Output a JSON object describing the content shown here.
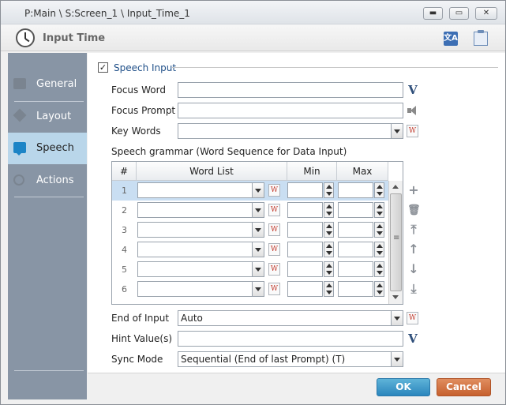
{
  "window": {
    "title": "P:Main \\ S:Screen_1 \\ Input_Time_1",
    "controls": {
      "minimize": "▬",
      "maximize": "▭",
      "close": "✕"
    }
  },
  "header": {
    "title": "Input Time",
    "icons": [
      "clock-icon",
      "translate-icon",
      "clipboard-icon"
    ]
  },
  "sidebar": {
    "items": [
      {
        "label": "General",
        "icon": "general-icon",
        "active": false
      },
      {
        "label": "Layout",
        "icon": "layout-icon",
        "active": false
      },
      {
        "label": "Speech",
        "icon": "speech-icon",
        "active": true
      },
      {
        "label": "Actions",
        "icon": "actions-icon",
        "active": false
      }
    ]
  },
  "speech": {
    "section_title": "Speech Input",
    "section_checked": true,
    "checkbox_mark": "✓",
    "focus_word": {
      "label": "Focus Word",
      "value": ""
    },
    "focus_prompt": {
      "label": "Focus Prompt",
      "value": ""
    },
    "key_words": {
      "label": "Key Words",
      "value": ""
    },
    "grammar_title": "Speech grammar (Word Sequence for Data Input)",
    "table": {
      "columns": [
        "#",
        "Word List",
        "Min",
        "Max"
      ],
      "rows": [
        {
          "num": "1",
          "word_list": "",
          "min": "",
          "max": ""
        },
        {
          "num": "2",
          "word_list": "",
          "min": "",
          "max": ""
        },
        {
          "num": "3",
          "word_list": "",
          "min": "",
          "max": ""
        },
        {
          "num": "4",
          "word_list": "",
          "min": "",
          "max": ""
        },
        {
          "num": "5",
          "word_list": "",
          "min": "",
          "max": ""
        },
        {
          "num": "6",
          "word_list": "",
          "min": "",
          "max": ""
        }
      ],
      "selected_row": "1"
    },
    "end_of_input": {
      "label": "End of Input",
      "value": "Auto"
    },
    "hint_value": {
      "label": "Hint Value(s)",
      "value": ""
    },
    "sync_mode": {
      "label": "Sync Mode",
      "value": "Sequential (End of last Prompt) (T)"
    },
    "glyphs": {
      "variable": "V",
      "wordlist": "W",
      "add": "+",
      "delete": "🗑",
      "top": "⤒",
      "up": "↑",
      "down": "↓",
      "bottom": "⤓"
    }
  },
  "footer": {
    "ok_label": "OK",
    "cancel_label": "Cancel"
  }
}
